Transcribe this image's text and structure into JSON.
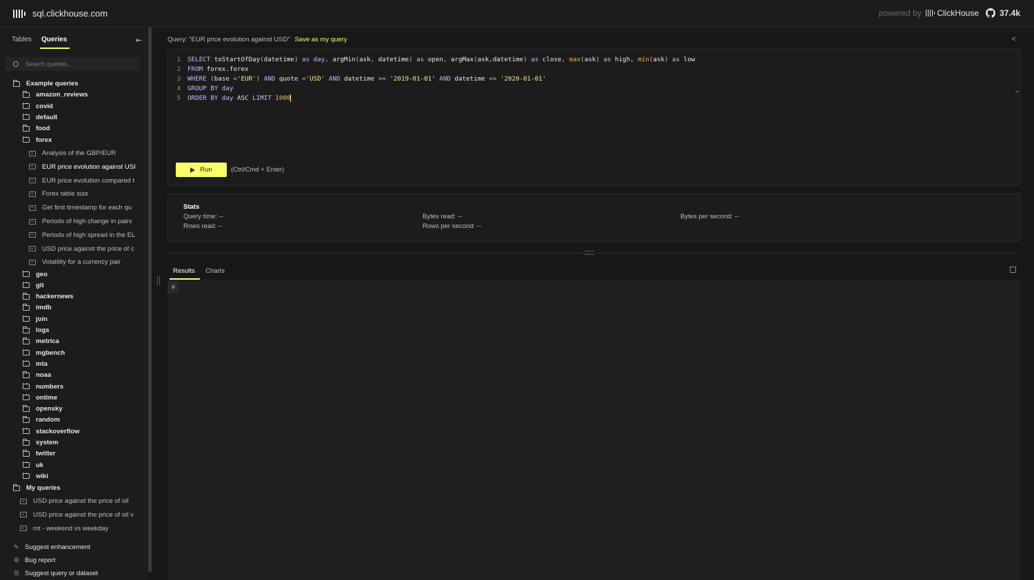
{
  "header": {
    "site": "sql.clickhouse.com",
    "powered_by": "powered by",
    "brand": "ClickHouse",
    "github_stars": "37.4k"
  },
  "sidebar": {
    "tabs": [
      "Tables",
      "Queries"
    ],
    "active_tab": "Queries",
    "search_placeholder": "Search queries...",
    "example_root": "Example queries",
    "folders_before": [
      "amazon_reviews",
      "covid",
      "default",
      "food"
    ],
    "open_folder": "forex",
    "forex_queries": [
      "Analysis of the GBP/EUR",
      "EUR price evolution against USI",
      "EUR price evolution compared t",
      "Forex table size",
      "Get first timestamp for each qu",
      "Periods of high change in pairs",
      "Periods of high spread in the EL",
      "USD price against the price of c",
      "Volatility for a currency pair"
    ],
    "active_query_index": 1,
    "folders_after": [
      "geo",
      "git",
      "hackernews",
      "imdb",
      "join",
      "logs",
      "metrica",
      "mgbench",
      "mta",
      "noaa",
      "numbers",
      "ontime",
      "opensky",
      "random",
      "stackoverflow",
      "system",
      "twitter",
      "uk",
      "wiki"
    ],
    "my_root": "My queries",
    "my_queries": [
      "USD price against the price of oil",
      "USD price against the price of oil v",
      "mt - weekend vs weekday"
    ],
    "footer": [
      {
        "label": "Suggest enhancement",
        "icon": "lightbulb-icon"
      },
      {
        "label": "Bug report",
        "icon": "bug-icon"
      },
      {
        "label": "Suggest query or dataset",
        "icon": "list-icon"
      }
    ]
  },
  "query_bar": {
    "label": "Query: \"EUR price evolution against USD\"",
    "save": "Save as my query"
  },
  "editor": {
    "lines": [
      [
        [
          "kw",
          "SELECT "
        ],
        [
          "fn",
          "toStartOfDay"
        ],
        [
          "cm",
          "("
        ],
        [
          "fn",
          "datetime"
        ],
        [
          "cm",
          ") "
        ],
        [
          "kw",
          "as "
        ],
        [
          "kw",
          "day"
        ],
        [
          "cm",
          ", "
        ],
        [
          "fn",
          "argMin"
        ],
        [
          "cm",
          "("
        ],
        [
          "fn",
          "ask"
        ],
        [
          "cm",
          ", "
        ],
        [
          "fn",
          "datetime"
        ],
        [
          "cm",
          ") "
        ],
        [
          "kw",
          "as "
        ],
        [
          "fn",
          "open"
        ],
        [
          "cm",
          ", "
        ],
        [
          "fn",
          "argMax"
        ],
        [
          "cm",
          "("
        ],
        [
          "fn",
          "ask"
        ],
        [
          "cm",
          ","
        ],
        [
          "fn",
          "datetime"
        ],
        [
          "cm",
          ") "
        ],
        [
          "kw",
          "as "
        ],
        [
          "fn",
          "close"
        ],
        [
          "cm",
          ", "
        ],
        [
          "mk",
          "max"
        ],
        [
          "cm",
          "("
        ],
        [
          "fn",
          "ask"
        ],
        [
          "cm",
          ") "
        ],
        [
          "kw",
          "as "
        ],
        [
          "fn",
          "high"
        ],
        [
          "cm",
          ", "
        ],
        [
          "mk",
          "min"
        ],
        [
          "cm",
          "("
        ],
        [
          "fn",
          "ask"
        ],
        [
          "cm",
          ") "
        ],
        [
          "kw",
          "as "
        ],
        [
          "fn",
          "low"
        ]
      ],
      [
        [
          "kw",
          "FROM "
        ],
        [
          "fn",
          "forex.forex"
        ]
      ],
      [
        [
          "kw",
          "WHERE "
        ],
        [
          "cm",
          "("
        ],
        [
          "fn",
          "base "
        ],
        [
          "cm",
          "="
        ],
        [
          "str",
          "'EUR'"
        ],
        [
          "cm",
          ") "
        ],
        [
          "kw",
          "AND "
        ],
        [
          "fn",
          "quote "
        ],
        [
          "cm",
          "="
        ],
        [
          "str",
          "'USD' "
        ],
        [
          "kw",
          "AND "
        ],
        [
          "fn",
          "datetime "
        ],
        [
          "cm",
          ">= "
        ],
        [
          "str",
          "'2019-01-01' "
        ],
        [
          "kw",
          "AND "
        ],
        [
          "fn",
          "datetime "
        ],
        [
          "cm",
          "<= "
        ],
        [
          "str",
          "'2020-01-01'"
        ]
      ],
      [
        [
          "kw",
          "GROUP BY "
        ],
        [
          "kw",
          "day"
        ]
      ],
      [
        [
          "kw",
          "ORDER BY "
        ],
        [
          "kw",
          "day "
        ],
        [
          "fn",
          "ASC "
        ],
        [
          "kw",
          "LIMIT "
        ],
        [
          "num",
          "1000"
        ]
      ]
    ],
    "run_label": "Run",
    "shortcut": "(Ctrl/Cmd + Enter)"
  },
  "stats": {
    "title": "Stats",
    "query_time": "Query time: --",
    "rows_read": "Rows read: --",
    "bytes_read": "Bytes read: --",
    "rows_per_second": "Rows per second: --",
    "bytes_per_second": "Bytes per second: --"
  },
  "results": {
    "tabs": [
      "Results",
      "Charts"
    ],
    "active_tab": "Results",
    "hash": "#"
  },
  "colors": {
    "accent": "#faff69",
    "background": "#181818",
    "panel": "#1c1c1c"
  }
}
